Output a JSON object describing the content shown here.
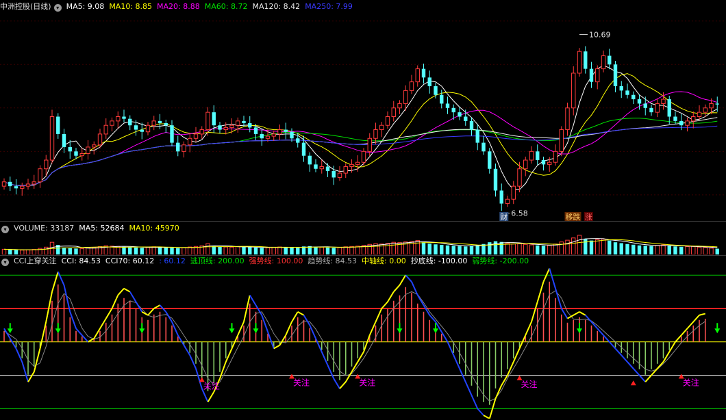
{
  "colors": {
    "up": "#ff3b3b",
    "down": "#54ffff",
    "ma5": "#ffffff",
    "ma10": "#ffff00",
    "ma20": "#ff00ff",
    "ma60": "#00e000",
    "ma120": "#f0f0f0",
    "ma250": "#3a3aff",
    "cci_line": "#ffff00",
    "cci_blue": "#2244ff"
  },
  "price_header": {
    "title": "中洲控股(日线)",
    "ma5": "MA5: 9.08",
    "ma10": "MA10: 8.85",
    "ma20": "MA20: 8.88",
    "ma60": "MA60: 8.72",
    "ma120": "MA120: 8.42",
    "ma250": "MA250: 7.99"
  },
  "price_annotations": {
    "high": "10.69",
    "low": "6.58",
    "marker1": "财",
    "marker2": "移跌",
    "marker3": "涨"
  },
  "volume_header": {
    "title": "VOLUME: 33187",
    "ma5": "MA5: 52684",
    "ma10": "MA10: 45970"
  },
  "cci_header": {
    "title": "CCI上穿关注",
    "cci": "CCI: 84.53",
    "cci70": "CCI70: 60.12",
    "blue": ": 60.12",
    "top": "逃顶线: 200.00",
    "strong": "强势线: 100.00",
    "trend": "趋势线: 84.53",
    "mid": "中轴线: 0.00",
    "bottom": "抄底线: -100.00",
    "weak": "弱势线: -200.00"
  },
  "cci_labels": {
    "watch": "关注"
  },
  "chart_data": [
    {
      "type": "candlestick",
      "title": "中洲控股(日线)",
      "annotated_high": 10.69,
      "annotated_low": 6.58,
      "close": [
        7.3,
        7.2,
        7.15,
        7.2,
        7.25,
        7.3,
        7.6,
        7.8,
        8.8,
        8.4,
        8.1,
        8.0,
        7.9,
        7.95,
        8.1,
        8.15,
        8.4,
        8.6,
        8.7,
        8.8,
        8.75,
        8.6,
        8.5,
        8.45,
        8.6,
        8.7,
        8.65,
        8.6,
        8.2,
        8.0,
        8.15,
        8.3,
        8.4,
        8.5,
        8.9,
        8.6,
        8.5,
        8.55,
        8.6,
        8.7,
        8.65,
        8.55,
        8.4,
        8.3,
        8.35,
        8.4,
        8.5,
        8.45,
        8.3,
        8.2,
        7.9,
        7.7,
        7.6,
        7.65,
        7.55,
        7.4,
        7.5,
        7.65,
        7.7,
        7.75,
        8.0,
        8.3,
        8.5,
        8.6,
        8.8,
        9.0,
        9.1,
        9.4,
        9.6,
        9.9,
        9.7,
        9.5,
        9.3,
        9.1,
        9.0,
        8.9,
        8.8,
        8.7,
        8.5,
        8.2,
        8.0,
        7.6,
        7.1,
        6.8,
        6.9,
        7.2,
        7.6,
        7.8,
        8.0,
        7.8,
        7.7,
        7.75,
        8.0,
        8.5,
        9.0,
        9.8,
        10.3,
        9.9,
        9.6,
        9.9,
        10.2,
        10.0,
        9.5,
        9.4,
        9.3,
        9.2,
        9.1,
        9.0,
        8.9,
        9.1,
        9.2,
        8.8,
        8.7,
        8.6,
        8.7,
        8.8,
        8.9,
        9.0,
        9.1,
        9.08
      ],
      "volume": [
        30000,
        28000,
        26000,
        25000,
        27000,
        29000,
        35000,
        42000,
        70000,
        55000,
        40000,
        36000,
        34000,
        33000,
        38000,
        40000,
        45000,
        50000,
        48000,
        46000,
        44000,
        42000,
        40000,
        38000,
        41000,
        44000,
        42000,
        40000,
        38000,
        36000,
        39000,
        43000,
        46000,
        50000,
        62000,
        48000,
        44000,
        43000,
        42000,
        45000,
        44000,
        42000,
        40000,
        38000,
        39000,
        41000,
        43000,
        42000,
        40000,
        38000,
        46000,
        48000,
        44000,
        42000,
        40000,
        38000,
        40000,
        44000,
        46000,
        48000,
        52000,
        58000,
        62000,
        60000,
        64000,
        70000,
        68000,
        72000,
        75000,
        80000,
        70000,
        62000,
        58000,
        55000,
        52000,
        50000,
        48000,
        46000,
        50000,
        55000,
        60000,
        70000,
        76000,
        72000,
        64000,
        60000,
        62000,
        58000,
        55000,
        52000,
        50000,
        52000,
        60000,
        72000,
        82000,
        95000,
        110000,
        90000,
        80000,
        85000,
        88000,
        80000,
        70000,
        65000,
        60000,
        56000,
        52000,
        50000,
        48000,
        52000,
        55000,
        50000,
        46000,
        44000,
        45000,
        46000,
        42000,
        40000,
        36000,
        33187
      ],
      "ma_values": {
        "MA5": 9.08,
        "MA10": 8.85,
        "MA20": 8.88,
        "MA60": 8.72,
        "MA120": 8.42,
        "MA250": 7.99
      },
      "volume_ma": {
        "MA5": 52684,
        "MA10": 45970
      },
      "ylim": [
        6.4,
        11.2
      ]
    },
    {
      "type": "line",
      "title": "CCI上穿关注",
      "series": [
        {
          "name": "CCI",
          "last": 84.53
        },
        {
          "name": "CCI70",
          "last": 60.12
        }
      ],
      "reference_lines": [
        {
          "name": "逃顶线",
          "value": 200.0
        },
        {
          "name": "强势线",
          "value": 100.0
        },
        {
          "name": "趋势线",
          "value": 84.53
        },
        {
          "name": "中轴线",
          "value": 0.0
        },
        {
          "name": "抄底线",
          "value": -100.0
        },
        {
          "name": "弱势线",
          "value": -200.0
        }
      ],
      "cci": [
        40,
        10,
        -20,
        -60,
        -120,
        -90,
        -20,
        60,
        150,
        210,
        170,
        90,
        40,
        20,
        0,
        10,
        40,
        70,
        100,
        140,
        160,
        150,
        120,
        90,
        80,
        100,
        110,
        90,
        60,
        20,
        -10,
        -40,
        -80,
        -140,
        -180,
        -150,
        -110,
        -60,
        -20,
        20,
        60,
        140,
        110,
        80,
        30,
        -20,
        -10,
        20,
        60,
        90,
        80,
        50,
        10,
        -30,
        -70,
        -110,
        -140,
        -120,
        -90,
        -60,
        -30,
        20,
        60,
        100,
        120,
        150,
        170,
        200,
        180,
        140,
        110,
        80,
        60,
        30,
        0,
        -40,
        -80,
        -120,
        -160,
        -200,
        -220,
        -230,
        -170,
        -130,
        -100,
        -60,
        -20,
        20,
        60,
        120,
        180,
        220,
        160,
        100,
        70,
        80,
        90,
        80,
        60,
        40,
        20,
        0,
        -20,
        -40,
        -60,
        -80,
        -100,
        -120,
        -100,
        -80,
        -60,
        -30,
        0,
        20,
        40,
        60,
        80,
        84.53
      ],
      "cci_axis": [
        -230,
        225
      ]
    }
  ]
}
